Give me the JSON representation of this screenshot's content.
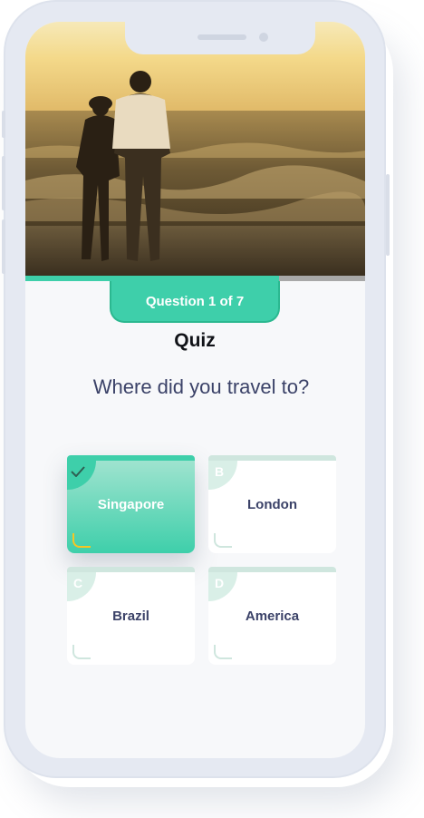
{
  "quiz": {
    "progress_label": "Question 1 of 7",
    "title": "Quiz",
    "question": "Where did you travel to?",
    "options": [
      {
        "letter": "",
        "label": "Singapore",
        "selected": true
      },
      {
        "letter": "B",
        "label": "London",
        "selected": false
      },
      {
        "letter": "C",
        "label": "Brazil",
        "selected": false
      },
      {
        "letter": "D",
        "label": "America",
        "selected": false
      }
    ]
  },
  "hero": {
    "icon": "couple-on-beach-photo"
  },
  "colors": {
    "accent": "#3ecfaa",
    "accent_dark": "#2bb890",
    "text_dark": "#3b4268",
    "selected_corner": "#f5c623"
  }
}
